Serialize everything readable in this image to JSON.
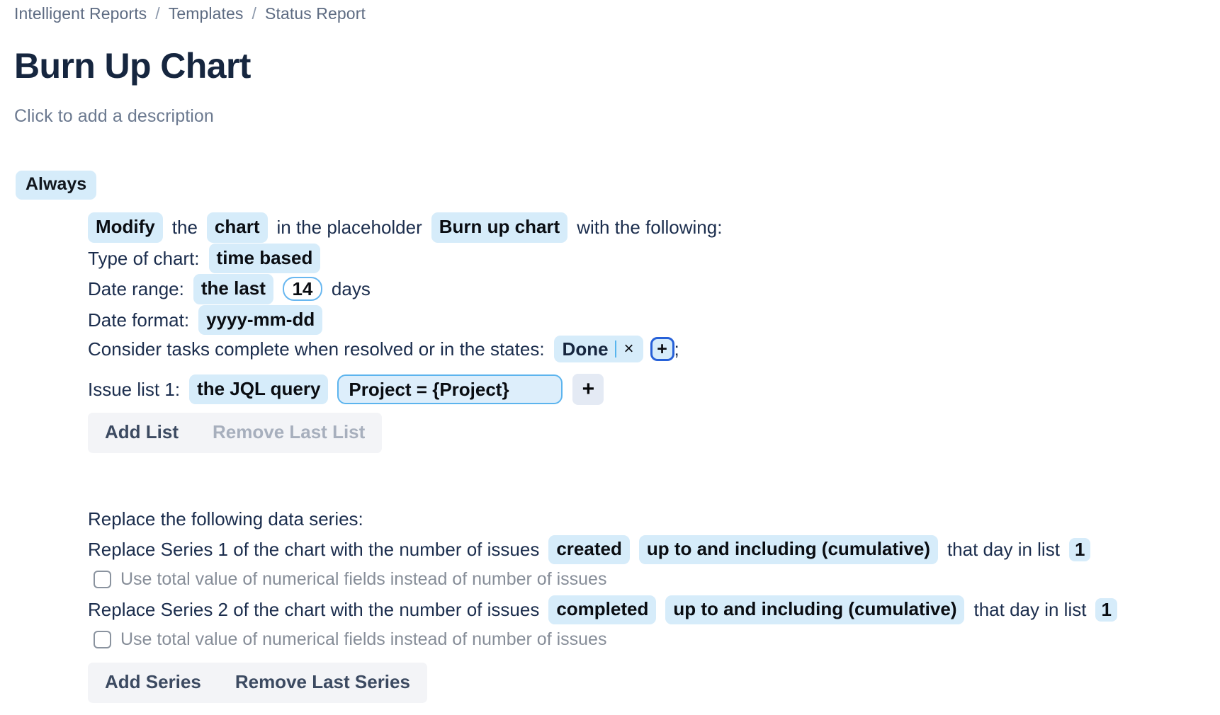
{
  "breadcrumb": {
    "items": [
      "Intelligent Reports",
      "Templates",
      "Status Report"
    ],
    "separator": "/"
  },
  "page": {
    "title": "Burn Up Chart",
    "description": "Click to add a description"
  },
  "rule": {
    "condition_label": "Always",
    "action": {
      "verb": "Modify",
      "text_the": "the",
      "object": "chart",
      "text_in_placeholder": "in the placeholder",
      "placeholder": "Burn up chart",
      "text_tail": "with the following:"
    },
    "chart_type": {
      "label": "Type of chart:",
      "value": "time based"
    },
    "date_range": {
      "label": "Date range:",
      "mode": "the last",
      "amount": "14",
      "unit": "days"
    },
    "date_format": {
      "label": "Date format:",
      "value": "yyyy-mm-dd"
    },
    "complete_states": {
      "label": "Consider tasks complete when resolved or in the states:",
      "tokens": [
        "Done"
      ],
      "clear_icon": "×",
      "add_icon": "+",
      "trailing": ";"
    },
    "issue_list": {
      "label": "Issue list 1:",
      "source": "the JQL query",
      "query": "Project = {Project}",
      "add_icon": "+"
    },
    "list_buttons": {
      "add": "Add List",
      "remove": "Remove Last List",
      "remove_disabled": true
    }
  },
  "series_section": {
    "heading": "Replace the following data series:",
    "items": [
      {
        "prefix": "Replace Series 1 of the chart with the number of issues",
        "event": "created",
        "aggregation": "up to and including (cumulative)",
        "middle": "that day in list",
        "list_number": "1",
        "checkbox_label": "Use total value of numerical fields instead of number of issues",
        "checked": false
      },
      {
        "prefix": "Replace Series 2 of the chart with the number of issues",
        "event": "completed",
        "aggregation": "up to and including (cumulative)",
        "middle": "that day in list",
        "list_number": "1",
        "checkbox_label": "Use total value of numerical fields instead of number of issues",
        "checked": false
      }
    ],
    "buttons": {
      "add": "Add Series",
      "remove": "Remove Last Series"
    }
  },
  "colors": {
    "chip_bg": "#d6ecfa",
    "text_primary": "#182a4e",
    "text_muted": "#6c7a90",
    "focus_ring": "#2761d8",
    "input_border": "#5cb4ee"
  }
}
